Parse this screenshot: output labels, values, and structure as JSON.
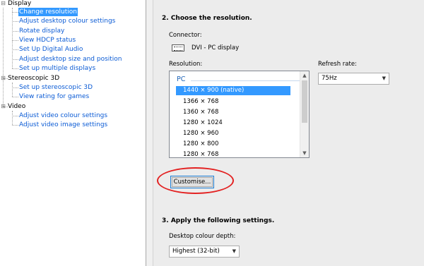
{
  "tree": {
    "groups": [
      {
        "label": "Display",
        "items": [
          {
            "label": "Change resolution",
            "selected": true
          },
          {
            "label": "Adjust desktop colour settings"
          },
          {
            "label": "Rotate display"
          },
          {
            "label": "View HDCP status"
          },
          {
            "label": "Set Up Digital Audio"
          },
          {
            "label": "Adjust desktop size and position"
          },
          {
            "label": "Set up multiple displays"
          }
        ]
      },
      {
        "label": "Stereoscopic 3D",
        "items": [
          {
            "label": "Set up stereoscopic 3D"
          },
          {
            "label": "View rating for games"
          }
        ]
      },
      {
        "label": "Video",
        "items": [
          {
            "label": "Adjust video colour settings"
          },
          {
            "label": "Adjust video image settings"
          }
        ]
      }
    ]
  },
  "main": {
    "section2_title": "2. Choose the resolution.",
    "connector_label": "Connector:",
    "connector_value": "DVI - PC display",
    "resolution_label": "Resolution:",
    "resolution_group": "PC",
    "resolutions": [
      "1440 × 900 (native)",
      "1366 × 768",
      "1360 × 768",
      "1280 × 1024",
      "1280 × 960",
      "1280 × 800",
      "1280 × 768"
    ],
    "selected_resolution": "1440 × 900 (native)",
    "refresh_label": "Refresh rate:",
    "refresh_value": "75Hz",
    "customise_label": "Customise...",
    "section3_title": "3. Apply the following settings.",
    "colour_depth_label": "Desktop colour depth:",
    "colour_depth_value": "Highest (32-bit)"
  },
  "colors": {
    "selection": "#3399ff",
    "link": "#0b5bd5",
    "annotation": "#e32222"
  }
}
